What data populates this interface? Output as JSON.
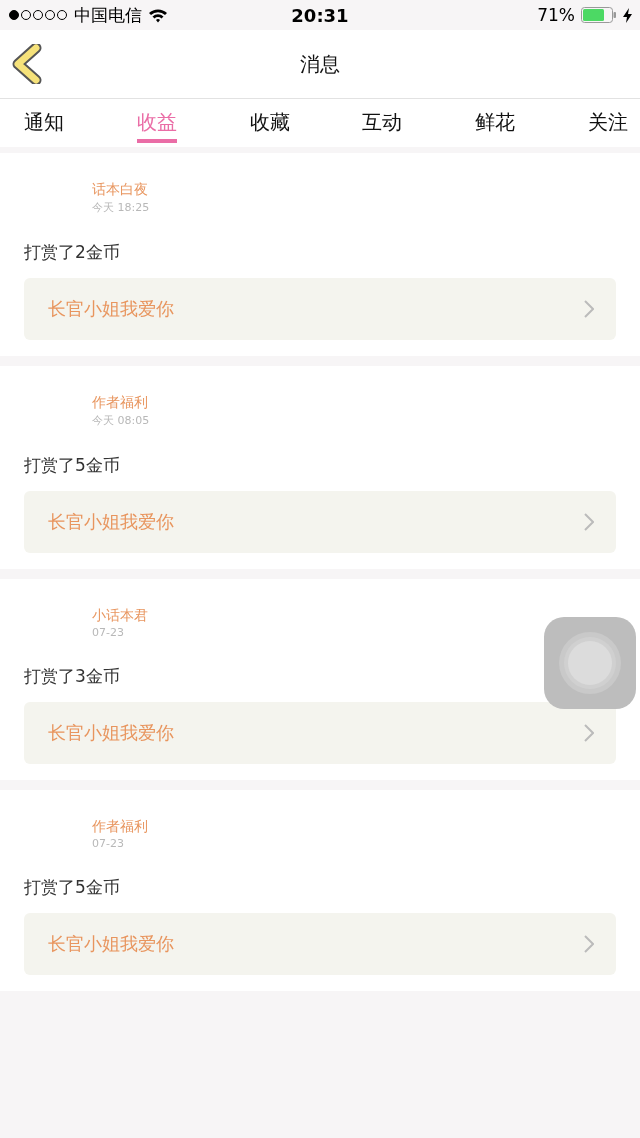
{
  "status_bar": {
    "carrier": "中国电信",
    "time": "20:31",
    "battery": "71%"
  },
  "nav": {
    "title": "消息"
  },
  "tabs": [
    {
      "label": "通知",
      "selected": false
    },
    {
      "label": "收益",
      "selected": true
    },
    {
      "label": "收藏",
      "selected": false
    },
    {
      "label": "互动",
      "selected": false
    },
    {
      "label": "鲜花",
      "selected": false
    },
    {
      "label": "关注",
      "selected": false
    }
  ],
  "messages": [
    {
      "sender": "话本白夜",
      "time": "今天 18:25",
      "text": "打赏了2金币",
      "story": "长官小姐我爱你"
    },
    {
      "sender": "作者福利",
      "time": "今天 08:05",
      "text": "打赏了5金币",
      "story": "长官小姐我爱你"
    },
    {
      "sender": "小话本君",
      "time": "07-23",
      "text": "打赏了3金币",
      "story": "长官小姐我爱你"
    },
    {
      "sender": "作者福利",
      "time": "07-23",
      "text": "打赏了5金币",
      "story": "长官小姐我爱你"
    }
  ]
}
